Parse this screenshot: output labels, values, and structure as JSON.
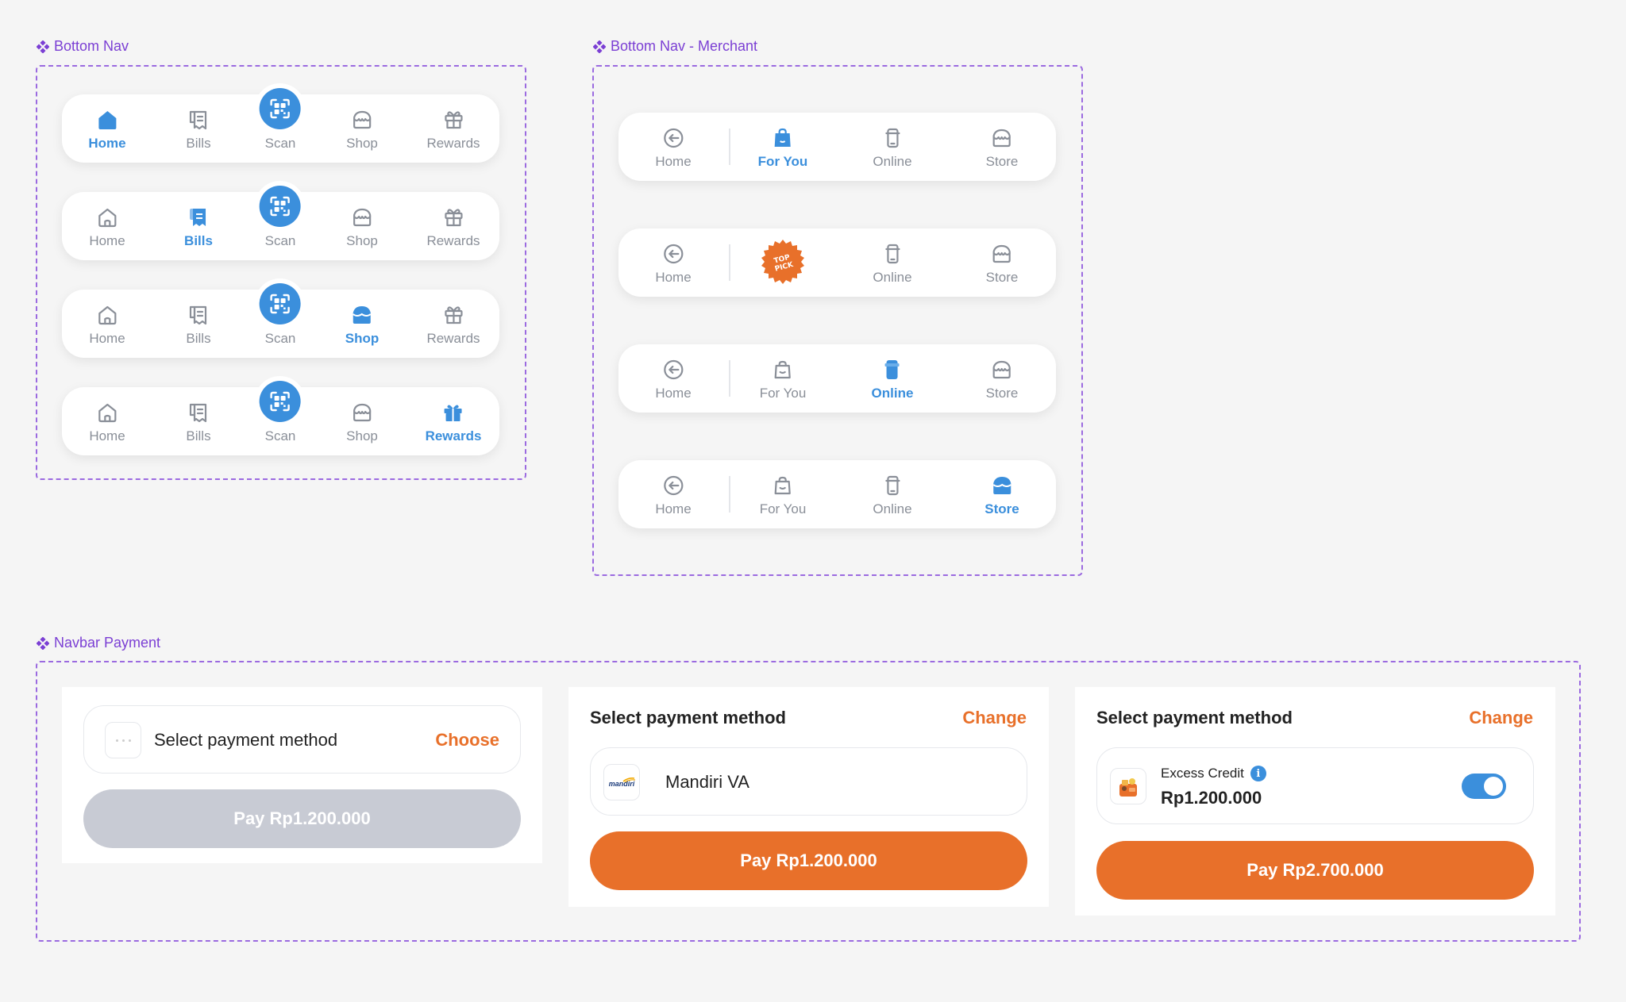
{
  "sections": {
    "bottom_nav": "Bottom Nav",
    "bottom_nav_merchant": "Bottom Nav - Merchant",
    "navbar_payment": "Navbar Payment"
  },
  "bottom_nav": {
    "items": [
      "Home",
      "Bills",
      "Scan",
      "Shop",
      "Rewards"
    ],
    "active_states": [
      "Home",
      "Bills",
      "Shop",
      "Rewards"
    ]
  },
  "merchant_nav": {
    "items": [
      "Home",
      "For You",
      "Online",
      "Store"
    ],
    "badge_text": "TOP PICK"
  },
  "payment": {
    "card1": {
      "placeholder": "Select payment method",
      "choose": "Choose",
      "pay": "Pay Rp1.200.000"
    },
    "card2": {
      "title": "Select payment method",
      "change": "Change",
      "method": "Mandiri VA",
      "bank_logo": "mandiri",
      "pay": "Pay Rp1.200.000"
    },
    "card3": {
      "title": "Select payment method",
      "change": "Change",
      "credit_label": "Excess Credit",
      "credit_amount": "Rp1.200.000",
      "pay": "Pay Rp2.700.000"
    }
  },
  "colors": {
    "accent": "#3b8fdc",
    "orange": "#e8702a",
    "frame": "#9b6ae0"
  }
}
